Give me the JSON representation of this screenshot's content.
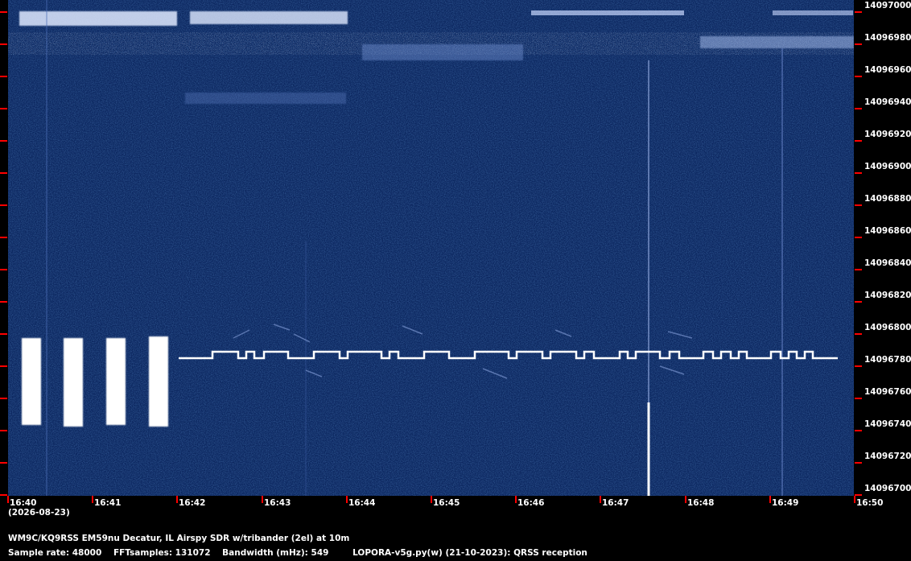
{
  "chart_data": {
    "type": "heatmap",
    "x_ticks": [
      "16:40",
      "16:41",
      "16:42",
      "16:43",
      "16:44",
      "16:45",
      "16:46",
      "16:47",
      "16:48",
      "16:49",
      "16:50"
    ],
    "y_ticks": [
      "14097000",
      "14096980",
      "14096960",
      "14096940",
      "14096920",
      "14096900",
      "14096880",
      "14096860",
      "14096840",
      "14096820",
      "14096800",
      "14096780",
      "14096760",
      "14096740",
      "14096720",
      "14096700"
    ],
    "ylim": [
      14096700,
      14097000
    ],
    "date": "(2026-08-23)"
  },
  "footer": {
    "station": "WM9C/KQ9RSS EM59nu Decatur, IL  Airspy SDR w/tribander (2el) at 10m",
    "sample_rate": "Sample rate: 48000",
    "fft": "FFTsamples: 131072",
    "bandwidth": "Bandwidth (mHz): 549",
    "software": "LOPORA-v5g.py(w) (21-10-2023): QRSS reception"
  },
  "colors": {
    "background": "#0d2a66",
    "tick": "#ff0000",
    "signal": "#ffffff"
  }
}
